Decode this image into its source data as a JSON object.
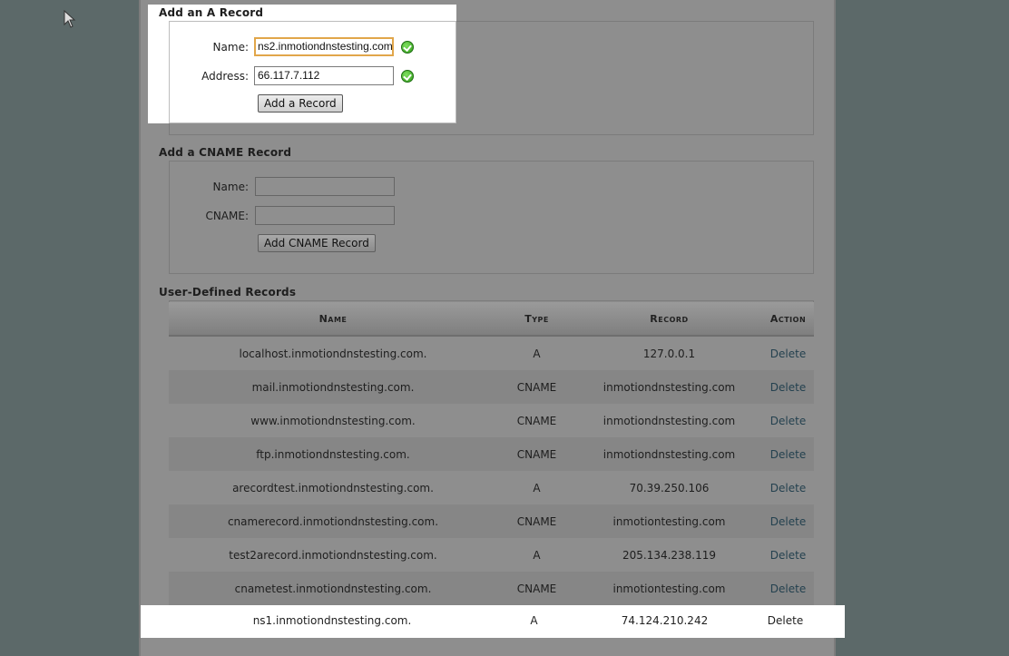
{
  "a_record": {
    "title": "Add an A Record",
    "name_label": "Name:",
    "name_value": "ns2.inmotiondnstesting.com",
    "address_label": "Address:",
    "address_value": "66.117.7.112",
    "submit_label": "Add a Record"
  },
  "cname_record": {
    "title": "Add a CNAME Record",
    "name_label": "Name:",
    "name_value": "",
    "cname_label": "CNAME:",
    "cname_value": "",
    "submit_label": "Add CNAME Record"
  },
  "records": {
    "title": "User-Defined Records",
    "columns": [
      "Name",
      "Type",
      "Record",
      "Action"
    ],
    "rows": [
      {
        "name": "localhost.inmotiondnstesting.com.",
        "type": "A",
        "record": "127.0.0.1",
        "action": "Delete"
      },
      {
        "name": "mail.inmotiondnstesting.com.",
        "type": "CNAME",
        "record": "inmotiondnstesting.com",
        "action": "Delete"
      },
      {
        "name": "www.inmotiondnstesting.com.",
        "type": "CNAME",
        "record": "inmotiondnstesting.com",
        "action": "Delete"
      },
      {
        "name": "ftp.inmotiondnstesting.com.",
        "type": "CNAME",
        "record": "inmotiondnstesting.com",
        "action": "Delete"
      },
      {
        "name": "arecordtest.inmotiondnstesting.com.",
        "type": "A",
        "record": "70.39.250.106",
        "action": "Delete"
      },
      {
        "name": "cnamerecord.inmotiondnstesting.com.",
        "type": "CNAME",
        "record": "inmotiontesting.com",
        "action": "Delete"
      },
      {
        "name": "test2arecord.inmotiondnstesting.com.",
        "type": "A",
        "record": "205.134.238.119",
        "action": "Delete"
      },
      {
        "name": "cnametest.inmotiondnstesting.com.",
        "type": "CNAME",
        "record": "inmotiontesting.com",
        "action": "Delete"
      },
      {
        "name": "ns1.inmotiondnstesting.com.",
        "type": "A",
        "record": "74.124.210.242",
        "action": "Delete"
      }
    ]
  },
  "colors": {
    "highlight": "#ffffff",
    "focus_border": "#e1a64a",
    "link": "#24414f",
    "valid_icon": "#2f9a19"
  },
  "icons": {
    "valid": "green-checkmark-icon",
    "cursor": "mouse-pointer-icon"
  }
}
